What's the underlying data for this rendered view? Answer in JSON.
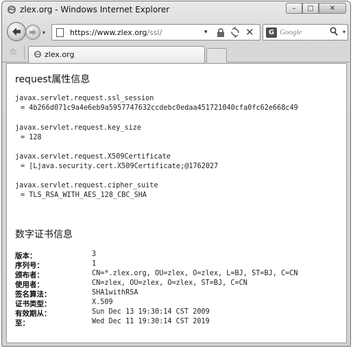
{
  "window": {
    "title": "zlex.org - Windows Internet Explorer",
    "controls": {
      "minimize": "–",
      "maximize": "□",
      "close": "✕"
    }
  },
  "navbar": {
    "url_host": "https://www.zlex.org",
    "url_path": "/ssl/",
    "search_placeholder": "Google",
    "search_icon_glyph": "G",
    "go_glyph": "⌕",
    "refresh_glyph": "⁺⁄₊",
    "stop_glyph": "✕",
    "dropdown_glyph": "▾"
  },
  "tabs": [
    {
      "label": "zlex.org"
    }
  ],
  "content": {
    "request_section_title": "request属性信息",
    "attributes": [
      {
        "name": "javax.servlet.request.ssl_session",
        "value": "= 4b266d071c9a4e6eb9a5957747632ccdebc0edaa451721040cfa0fc62e668c49"
      },
      {
        "name": "javax.servlet.request.key_size",
        "value": "= 128"
      },
      {
        "name": "javax.servlet.request.X509Certificate",
        "value": "= [Ljava.security.cert.X509Certificate;@1762027"
      },
      {
        "name": "javax.servlet.request.cipher_suite",
        "value": "= TLS_RSA_WITH_AES_128_CBC_SHA"
      }
    ],
    "cert_section_title": "数字证书信息",
    "cert_fields": [
      {
        "label": "版本：",
        "value": "3"
      },
      {
        "label": "序列号：",
        "value": "1"
      },
      {
        "label": "颁布者：",
        "value": "CN=*.zlex.org, OU=zlex, O=zlex, L=BJ, ST=BJ, C=CN"
      },
      {
        "label": "使用者：",
        "value": "CN=zlex, OU=zlex, O=zlex, ST=BJ, C=CN"
      },
      {
        "label": "签名算法：",
        "value": "SHA1withRSA"
      },
      {
        "label": "证书类型：",
        "value": "X.509"
      },
      {
        "label": "有效期从：",
        "value": "Sun Dec 13 19:30:14 CST 2009"
      },
      {
        "label": "至：",
        "value": "Wed Dec 11 19:30:14 CST 2019"
      }
    ]
  }
}
